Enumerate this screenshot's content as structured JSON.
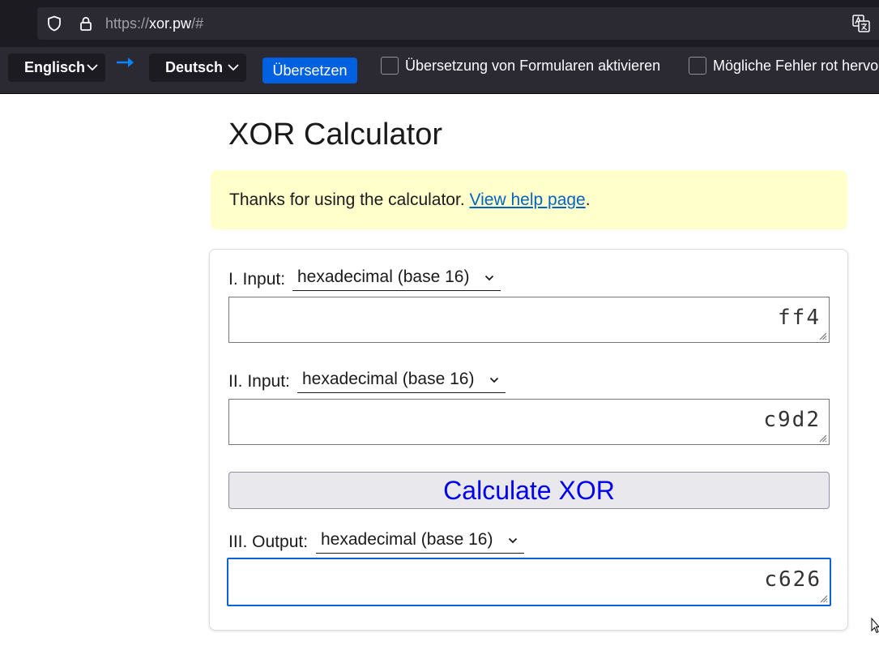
{
  "browser": {
    "url_prefix": "https://",
    "url_host": "xor.pw",
    "url_suffix": "/#"
  },
  "translation_bar": {
    "source_language": "Englisch",
    "target_language": "Deutsch",
    "translate_button": "Übersetzen",
    "option_forms": "Übersetzung von Formularen aktivieren",
    "option_errors": "Mögliche Fehler rot hervo",
    "accent_color": "#0061e0"
  },
  "page": {
    "title": "XOR Calculator",
    "notice": {
      "text": "Thanks for using the calculator. ",
      "link": "View help page",
      "trailing": "."
    },
    "input1": {
      "label": "I. Input:",
      "base": "hexadecimal (base 16)",
      "value": "ff4"
    },
    "input2": {
      "label": "II. Input:",
      "base": "hexadecimal (base 16)",
      "value": "c9d2"
    },
    "calculate_button": "Calculate XOR",
    "output": {
      "label": "III. Output:",
      "base": "hexadecimal (base 16)",
      "value": "c626"
    },
    "notice_bg": "#ffffcc",
    "link_color": "#0563c1",
    "button_text_color": "#0000ee"
  }
}
